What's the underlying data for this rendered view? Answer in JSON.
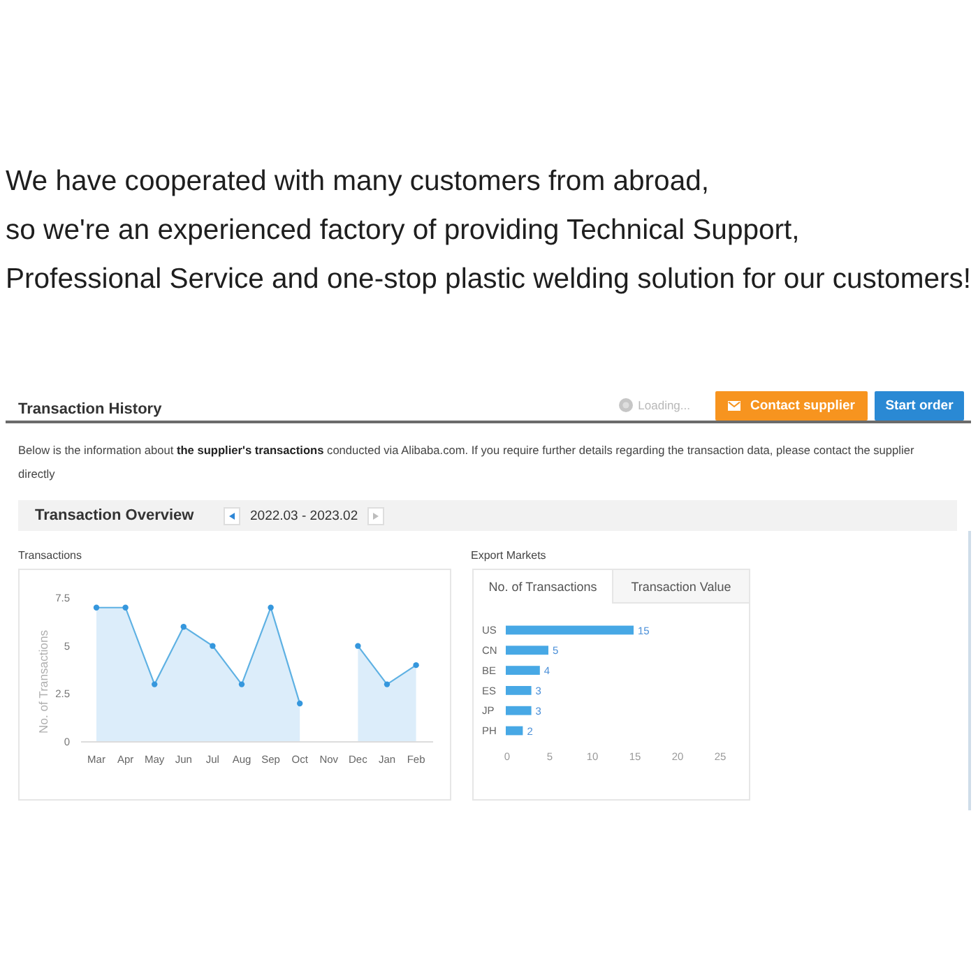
{
  "intro": {
    "lines": [
      "We have cooperated with many customers from abroad,",
      "so we're an experienced factory of providing Technical Support,",
      "Professional Service and one-stop plastic welding solution for our customers!"
    ]
  },
  "transaction_history": {
    "title": "Transaction History",
    "loading": "Loading...",
    "buttons": [
      {
        "kind": "contact",
        "label": "Contact supplier"
      },
      {
        "kind": "order",
        "label": "Start order"
      }
    ],
    "description": "Below is the information about **the supplier's transactions** conducted via Alibaba.com. If you require further details regarding the transaction data, please contact the supplier directly",
    "overview": {
      "title": "Transaction Overview",
      "date_range": "2022.03 - 2023.02",
      "nav": [
        {
          "kind": "previous",
          "disabled": false
        },
        {
          "kind": "next",
          "disabled": true
        }
      ]
    },
    "transactions": {
      "label": "Transactions",
      "chart_data": {
        "type": "area",
        "ylabel": "No. of Transactions",
        "categories": [
          "Mar",
          "Apr",
          "May",
          "Jun",
          "Jul",
          "Aug",
          "Sep",
          "Oct",
          "Nov",
          "Dec",
          "Jan",
          "Feb"
        ],
        "values": [
          7,
          7,
          3,
          6,
          5,
          3,
          7,
          2,
          null,
          5,
          3,
          4
        ],
        "ylim": [
          0,
          7.5
        ],
        "yticks": [
          0,
          2.5,
          5,
          7.5
        ]
      }
    },
    "export_markets": {
      "label": "Export Markets",
      "tabs": [
        {
          "label": "No. of Transactions",
          "selected": true
        },
        {
          "label": "Transaction Value",
          "selected": false
        }
      ],
      "chart_data": {
        "type": "bar",
        "orientation": "horizontal",
        "categories": [
          "US",
          "CN",
          "BE",
          "ES",
          "JP",
          "PH"
        ],
        "values": [
          15,
          5,
          4,
          3,
          3,
          2
        ],
        "xlim": [
          0,
          25
        ],
        "xticks": [
          0,
          5,
          10,
          15,
          20,
          25
        ],
        "data_labels": true
      }
    }
  }
}
